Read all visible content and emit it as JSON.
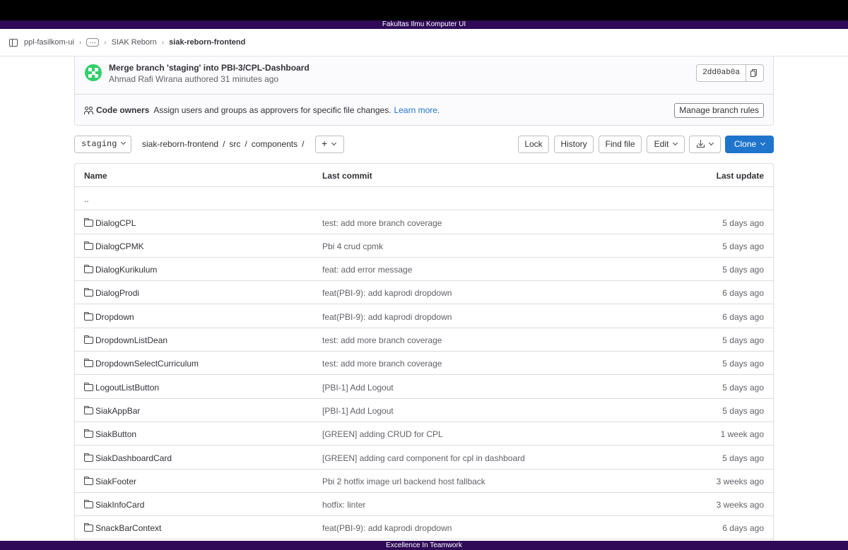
{
  "brand_bar": "Fakultas Ilmu Komputer UI",
  "footer_bar": "Excellence In Teamwork",
  "breadcrumb": {
    "items": [
      "ppl-fasilkom-ui",
      "…",
      "SIAK Reborn",
      "siak-reborn-frontend"
    ]
  },
  "commit": {
    "title": "Merge branch 'staging' into PBI-3/CPL-Dashboard",
    "meta": "Ahmad Rafi Wirana authored 31 minutes ago",
    "sha": "2dd0ab0a"
  },
  "code_owners": {
    "label": "Code owners",
    "text": "Assign users and groups as approvers for specific file changes.",
    "link": "Learn more.",
    "manage_button": "Manage branch rules"
  },
  "toolbar": {
    "branch": "staging",
    "path": [
      "siak-reborn-frontend",
      "src",
      "components"
    ],
    "plus": "+",
    "lock": "Lock",
    "history": "History",
    "find_file": "Find file",
    "edit": "Edit",
    "clone": "Clone"
  },
  "table": {
    "headers": {
      "name": "Name",
      "last_commit": "Last commit",
      "last_update": "Last update"
    },
    "parent": "..",
    "rows": [
      {
        "name": "DialogCPL",
        "commit": "test: add more branch coverage",
        "date": "5 days ago"
      },
      {
        "name": "DialogCPMK",
        "commit": "Pbi 4 crud cpmk",
        "date": "5 days ago"
      },
      {
        "name": "DialogKurikulum",
        "commit": "feat: add error message",
        "date": "5 days ago"
      },
      {
        "name": "DialogProdi",
        "commit": "feat(PBI-9): add kaprodi dropdown",
        "date": "6 days ago"
      },
      {
        "name": "Dropdown",
        "commit": "feat(PBI-9): add kaprodi dropdown",
        "date": "6 days ago"
      },
      {
        "name": "DropdownListDean",
        "commit": "test: add more branch coverage",
        "date": "5 days ago"
      },
      {
        "name": "DropdownSelectCurriculum",
        "commit": "test: add more branch coverage",
        "date": "5 days ago"
      },
      {
        "name": "LogoutListButton",
        "commit": "[PBI-1] Add Logout",
        "date": "5 days ago"
      },
      {
        "name": "SiakAppBar",
        "commit": "[PBI-1] Add Logout",
        "date": "5 days ago"
      },
      {
        "name": "SiakButton",
        "commit": "[GREEN] adding CRUD for CPL",
        "date": "1 week ago"
      },
      {
        "name": "SiakDashboardCard",
        "commit": "[GREEN] adding card component for cpl in dashboard",
        "date": "5 days ago"
      },
      {
        "name": "SiakFooter",
        "commit": "Pbi 2 hotfix image url backend host fallback",
        "date": "3 weeks ago"
      },
      {
        "name": "SiakInfoCard",
        "commit": "hotfix: linter",
        "date": "3 weeks ago"
      },
      {
        "name": "SnackBarContext",
        "commit": "feat(PBI-9): add kaprodi dropdown",
        "date": "6 days ago"
      }
    ]
  }
}
